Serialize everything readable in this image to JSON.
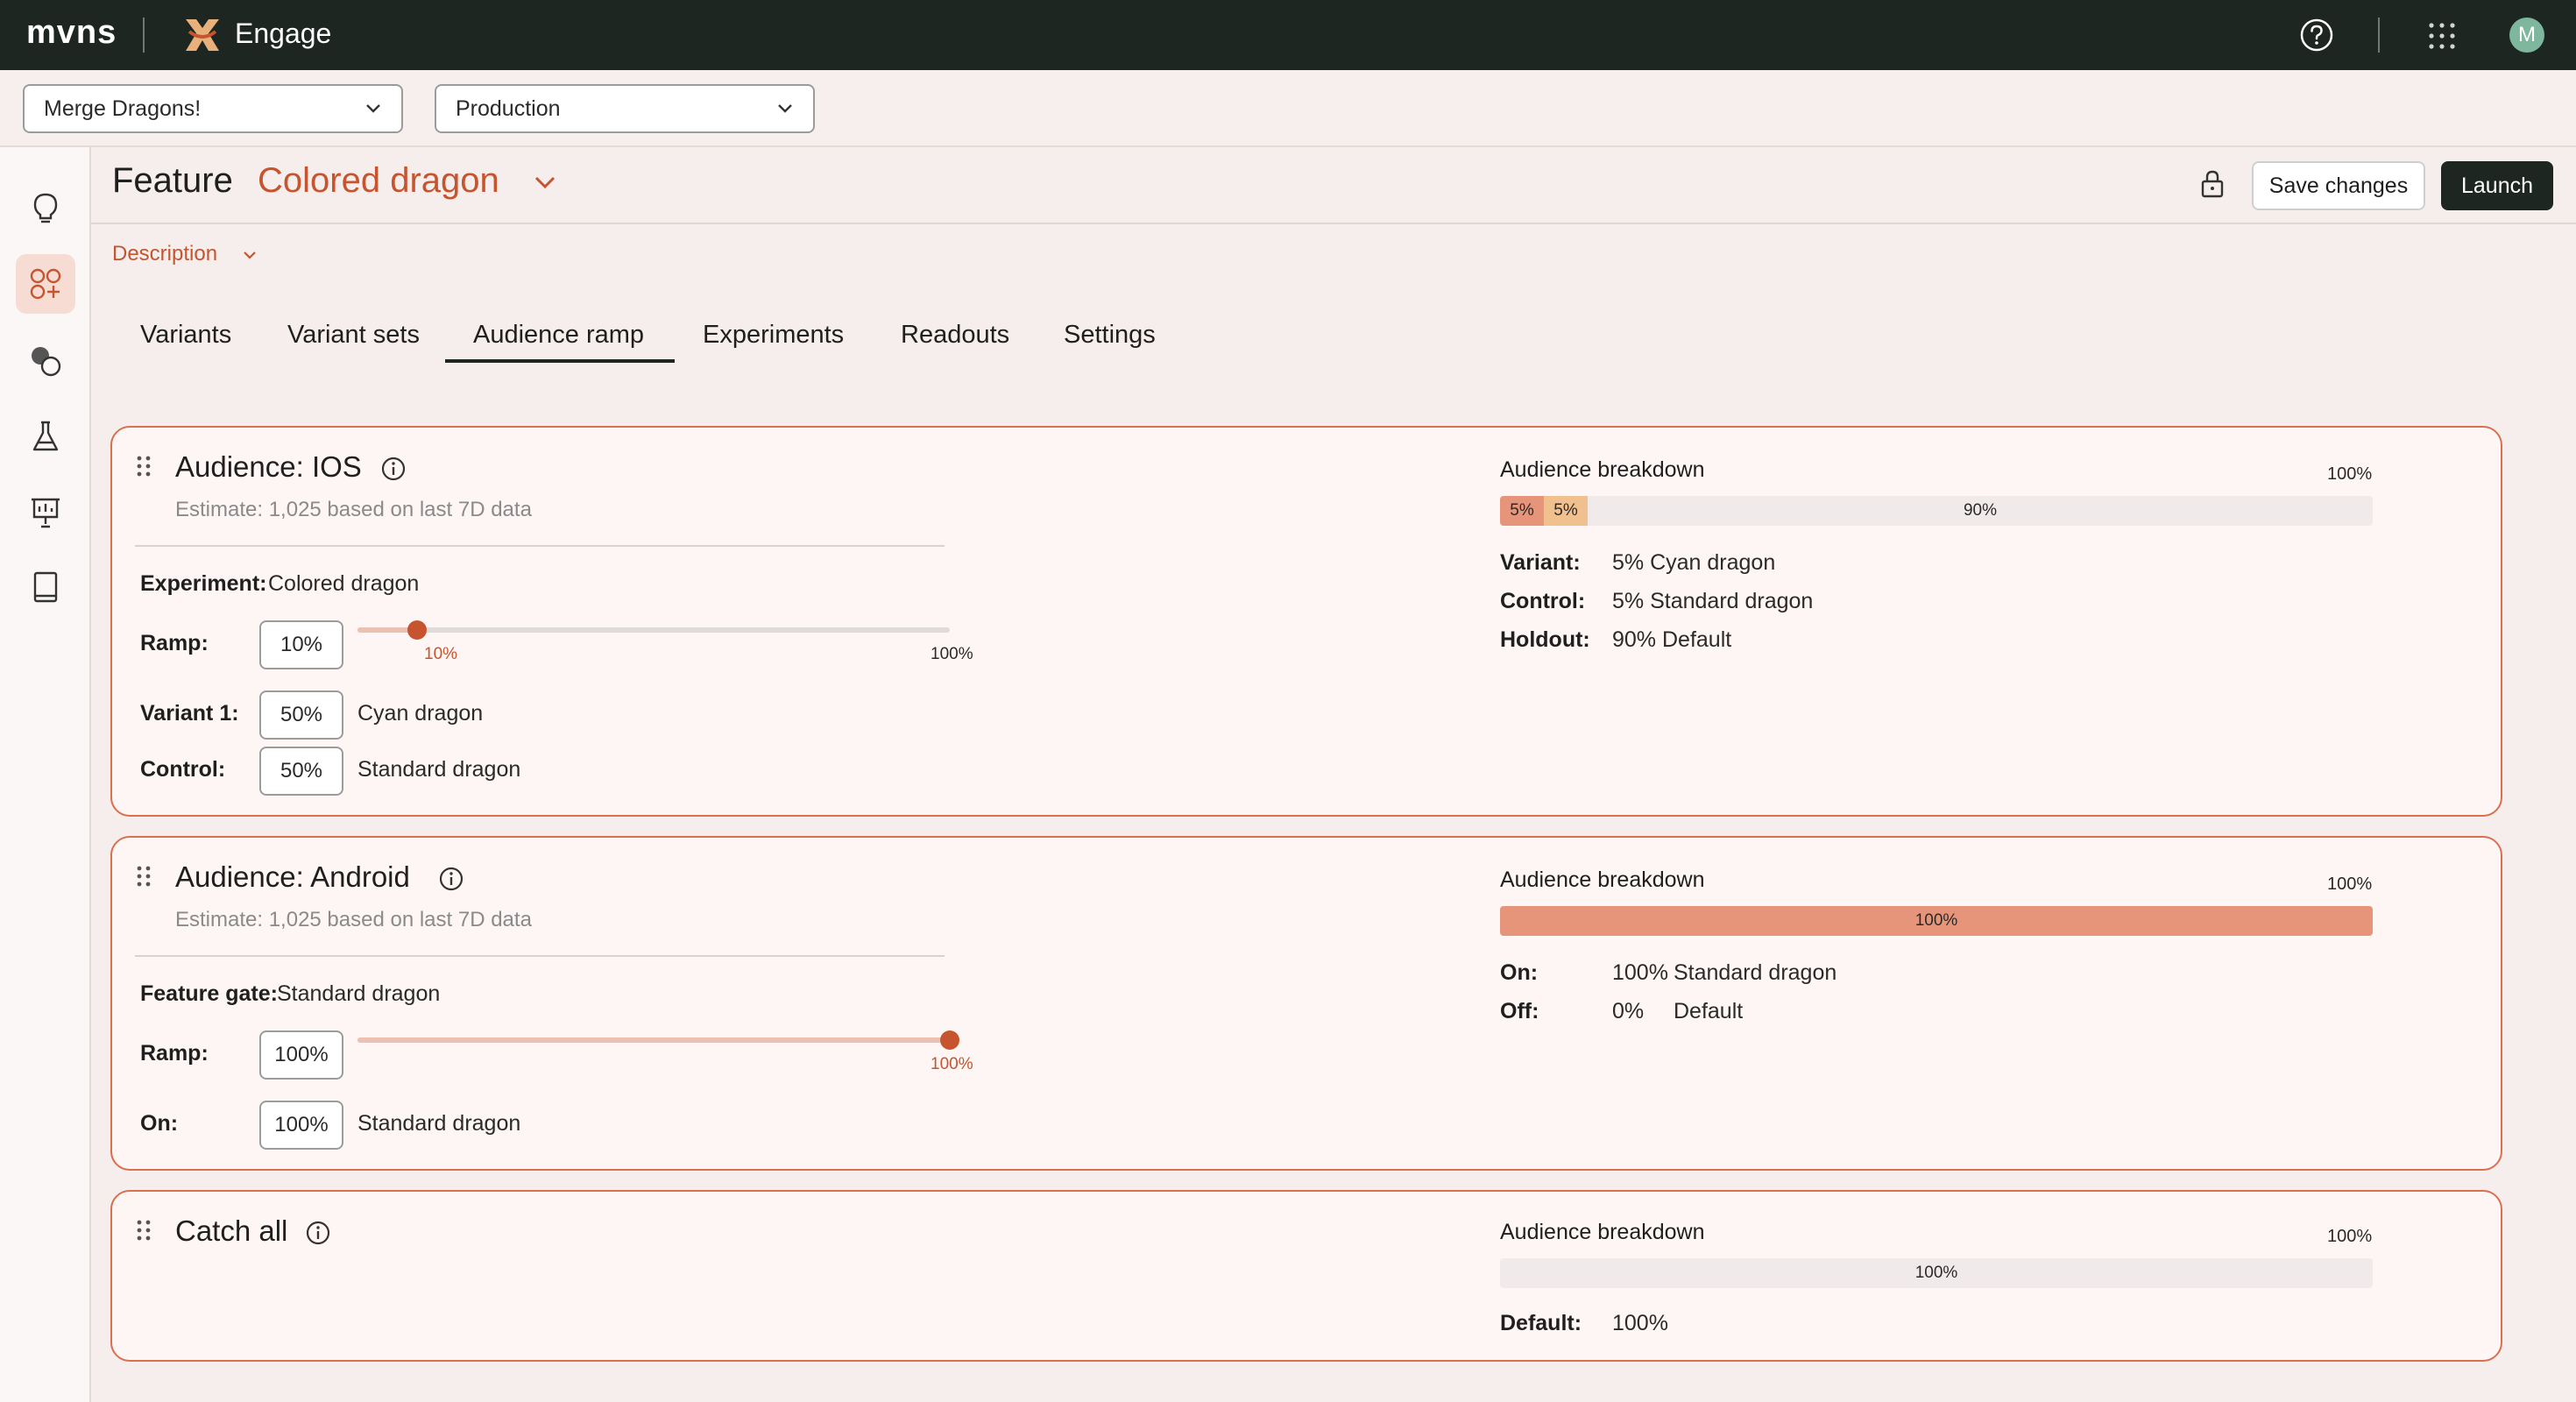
{
  "topbar": {
    "logo": "mvns",
    "app_name": "Engage",
    "avatar_initial": "M",
    "icons": [
      "engage-logo-icon",
      "help-icon",
      "apps-grid-icon"
    ]
  },
  "selectors": {
    "game": "Merge Dragons!",
    "environment": "Production"
  },
  "sidebar": {
    "items": [
      "lightbulb-icon",
      "features-icon",
      "variants-icon",
      "experiments-flask-icon",
      "presentation-icon",
      "book-icon"
    ],
    "active_index": 1
  },
  "header": {
    "feature_label": "Feature",
    "feature_name": "Colored dragon",
    "save_label": "Save changes",
    "launch_label": "Launch",
    "description_label": "Description"
  },
  "tabs": [
    {
      "label": "Variants"
    },
    {
      "label": "Variant sets"
    },
    {
      "label": "Audience ramp",
      "active": true
    },
    {
      "label": "Experiments"
    },
    {
      "label": "Readouts"
    },
    {
      "label": "Settings"
    }
  ],
  "colors": {
    "accent": "#c6542f",
    "card_border": "#d9704f",
    "bar_variant": "#e6947a",
    "bar_control": "#f0c08e",
    "bar_on": "#e6957b",
    "topbar": "#1d2621"
  },
  "cards": {
    "ios": {
      "title": "Audience: IOS",
      "estimate": "Estimate: 1,025 based on last 7D data",
      "experiment_label": "Experiment:",
      "experiment_value": "Colored dragon",
      "ramp_label": "Ramp:",
      "ramp_value": "10%",
      "ramp_level": 0.1,
      "ramp_slider_value": "10%",
      "ramp_slider_max": "100%",
      "variant_label": "Variant 1:",
      "variant_pct": "50%",
      "variant_name": "Cyan dragon",
      "control_label": "Control:",
      "control_pct": "50%",
      "control_name": "Standard dragon",
      "breakdown": {
        "title": "Audience breakdown",
        "max": "100%",
        "segments": [
          {
            "label": "5%",
            "fraction": 0.05
          },
          {
            "label": "5%",
            "fraction": 0.05
          },
          {
            "label": "90%",
            "fraction": 0.9
          }
        ],
        "rows": [
          {
            "label": "Variant:",
            "value": "5% Cyan dragon"
          },
          {
            "label": "Control:",
            "value": "5% Standard dragon"
          },
          {
            "label": "Holdout:",
            "value": "90% Default"
          }
        ]
      }
    },
    "android": {
      "title": "Audience: Android",
      "estimate": "Estimate: 1,025 based on last 7D data",
      "gate_label": "Feature gate:",
      "gate_value": "Standard dragon",
      "ramp_label": "Ramp:",
      "ramp_value": "100%",
      "ramp_level": 1.0,
      "ramp_slider_value": "100%",
      "on_label": "On:",
      "on_pct": "100%",
      "on_name": "Standard dragon",
      "breakdown": {
        "title": "Audience breakdown",
        "max": "100%",
        "segments": [
          {
            "label": "100%",
            "fraction": 1.0
          }
        ],
        "rows": [
          {
            "label": "On:",
            "pct": "100%",
            "value": "Standard dragon"
          },
          {
            "label": "Off:",
            "pct": "0%",
            "value": "Default"
          }
        ]
      }
    },
    "catch_all": {
      "title": "Catch all",
      "breakdown": {
        "title": "Audience breakdown",
        "max": "100%",
        "segments": [
          {
            "label": "100%",
            "fraction": 1.0
          }
        ],
        "rows": [
          {
            "label": "Default:",
            "value": "100%"
          }
        ]
      }
    }
  }
}
